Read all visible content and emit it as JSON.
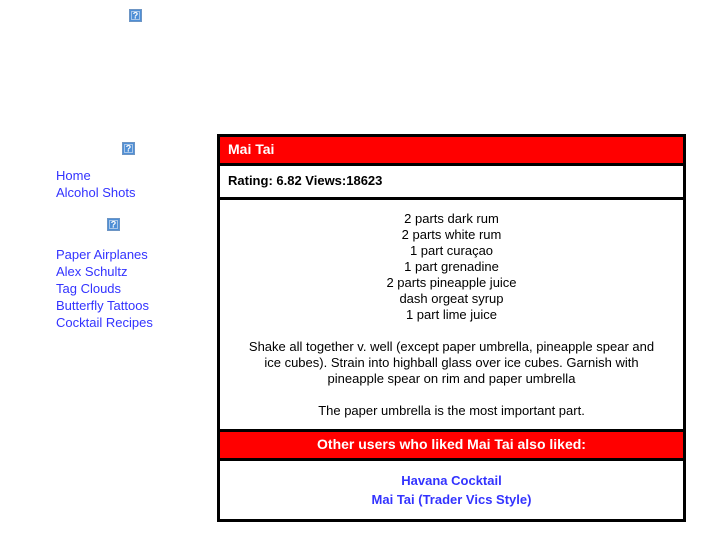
{
  "page": {
    "background_color": "#ffffff",
    "link_color": "#3333ff",
    "accent_color": "#ff0000",
    "border_color": "#000000"
  },
  "top_banner": {
    "icon_name": "broken-image-icon",
    "icon_glyph": "?"
  },
  "sidebar": {
    "icon_1_name": "broken-image-icon",
    "icon_2_name": "broken-image-icon",
    "primary_links": [
      {
        "label": "Home"
      },
      {
        "label": "Alcohol Shots"
      }
    ],
    "secondary_links": [
      {
        "label": "Paper Airplanes"
      },
      {
        "label": "Alex Schultz"
      },
      {
        "label": "Tag Clouds"
      },
      {
        "label": "Butterfly Tattoos"
      },
      {
        "label": "Cocktail Recipes"
      }
    ]
  },
  "recipe": {
    "title": "Mai Tai",
    "stats": "Rating: 6.82 Views:18623",
    "rating": "6.82",
    "views": "18623",
    "ingredients": [
      "2 parts dark rum",
      "2 parts white rum",
      "1 part curaçao",
      "1 part grenadine",
      "2 parts pineapple juice",
      "dash orgeat syrup",
      "1 part lime juice"
    ],
    "instructions": "Shake all together v. well (except paper umbrella, pineapple spear and ice cubes). Strain into highball glass over ice cubes. Garnish with pineapple spear on rim and paper umbrella",
    "note": "The paper umbrella is the most important part."
  },
  "related": {
    "heading": "Other users who liked Mai Tai also liked:",
    "links": [
      {
        "label": "Havana Cocktail"
      },
      {
        "label": "Mai Tai (Trader Vics Style)"
      }
    ]
  }
}
